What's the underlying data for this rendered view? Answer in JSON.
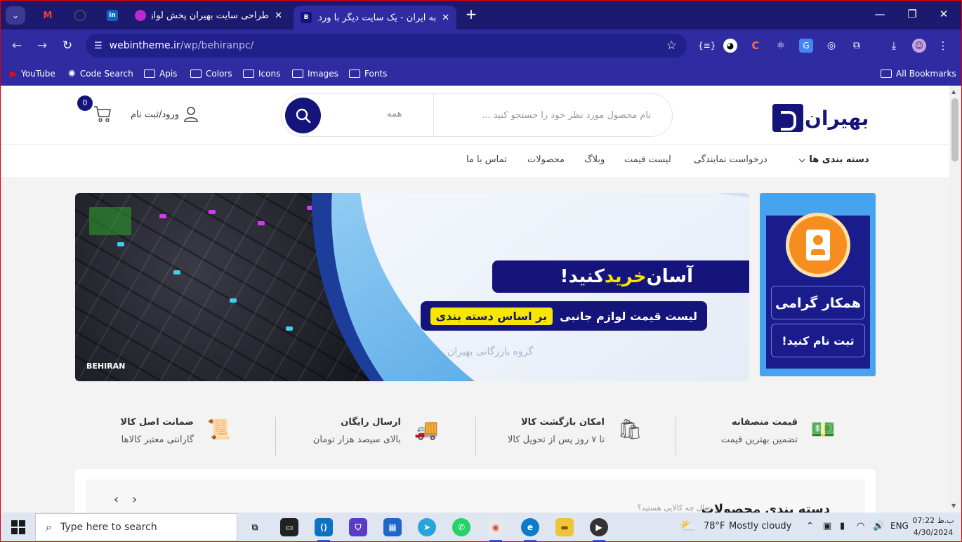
{
  "browser": {
    "tabs": [
      {
        "title": "",
        "favicon": "gmail",
        "color": "#ffffff"
      },
      {
        "title": "",
        "favicon": "github",
        "color": "#555555"
      },
      {
        "title": "",
        "favicon": "linkedin",
        "color": "#0a66c2"
      },
      {
        "title": "طراحی سایت بهیران پخش لوازم جا",
        "favicon": "app-icon",
        "color": "#c026d3"
      },
      {
        "title": "به ایران - یک سایت دیگر با وردپرس",
        "favicon": "behiran",
        "color": "#14147a"
      }
    ],
    "url": {
      "host": "webintheme.ir",
      "path": "/wp/behiranpc/"
    },
    "bookmarks": [
      {
        "label": "YouTube",
        "icon": "youtube-icon"
      },
      {
        "label": "Code Search",
        "icon": "code-search-icon"
      },
      {
        "label": "Apis",
        "icon": "folder-icon"
      },
      {
        "label": "Colors",
        "icon": "folder-icon"
      },
      {
        "label": "Icons",
        "icon": "folder-icon"
      },
      {
        "label": "Images",
        "icon": "folder-icon"
      },
      {
        "label": "Fonts",
        "icon": "folder-icon"
      }
    ],
    "all_bookmarks": "All Bookmarks"
  },
  "site": {
    "logo_text": "بهیران",
    "search": {
      "placeholder": "نام محصول مورد نظر خود را جستجو کنید ...",
      "category": "همه"
    },
    "login_label": "ورود/ثبت نام",
    "cart_count": "0",
    "nav": {
      "categories": "دسته بندی ها",
      "items": [
        "درخواست نمایندگی",
        "لیست قیمت",
        "وبلاگ",
        "محصولات",
        "تماس با ما"
      ]
    },
    "hero": {
      "headline_pre": "آسان",
      "headline_hl": "خرید",
      "headline_post": "کنید!",
      "sub": "لیست قیمت لوازم جانبی",
      "sub_tag": "بر اساس دسته بندی",
      "watermark": "گروه بازرگانی بهیران",
      "logo_small": "BEHIRAN"
    },
    "side_banner": {
      "title": "همکار گرامی",
      "cta": "ثبت نام کنید!"
    },
    "features": [
      {
        "title": "قیمت منصفانه",
        "sub": "تضمین بهترین قیمت",
        "icon": "money-icon"
      },
      {
        "title": "امکان بازگشت کالا",
        "sub": "تا ۷ روز پس از تحویل کالا",
        "icon": "return-bag-icon"
      },
      {
        "title": "ارسال رایگان",
        "sub": "بالای سیصد هزار تومان",
        "icon": "truck-icon"
      },
      {
        "title": "ضمانت اصل کالا",
        "sub": "گارانتی معتبر کالاها",
        "icon": "certificate-icon"
      }
    ],
    "categories_section": {
      "title": "دسته بندی محصولات",
      "subtitle": "به دنبال چه کالایی هستید؟"
    }
  },
  "taskbar": {
    "search_placeholder": "Type here to search",
    "weather": {
      "temp": "78°F",
      "text": "Mostly cloudy"
    },
    "lang": "ENG",
    "time": "07:22 ب.ظ",
    "date": "4/30/2024"
  }
}
